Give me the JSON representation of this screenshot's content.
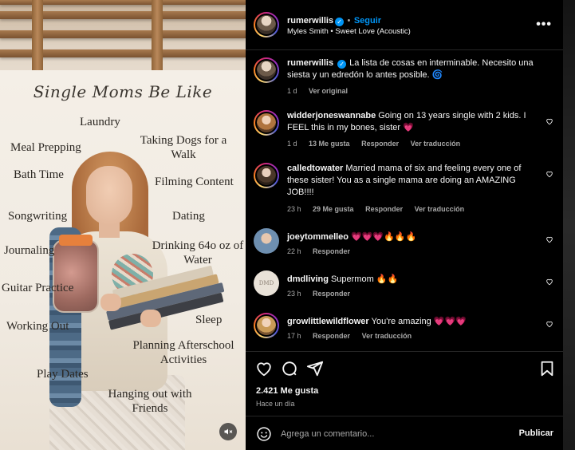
{
  "post": {
    "username": "rumerwillis",
    "verified_glyph": "✓",
    "separator": "•",
    "follow_label": "Seguir",
    "audio": "Myles Smith • Sweet Love (Acoustic)",
    "more_label": "•••"
  },
  "media": {
    "poster_title": "Single Moms Be Like",
    "words": [
      "Laundry",
      "Meal Prepping",
      "Taking Dogs for a Walk",
      "Bath Time",
      "Filming Content",
      "Songwriting",
      "Dating",
      "Journaling",
      "Drinking 64o oz of Water",
      "Guitar Practice",
      "Working Out",
      "Sleep",
      "Planning Afterschool Activities",
      "Play Dates",
      "Hanging out with Friends"
    ],
    "mute_icon": "speaker-muted-icon"
  },
  "caption": {
    "username": "rumerwillis",
    "text": "La lista de cosas en interminable. Necesito una siesta y un edredón lo antes posible. 🌀",
    "time": "1 d",
    "see_original": "Ver original"
  },
  "comments": [
    {
      "username": "widderjoneswannabe",
      "text": "Going on 13 years single with 2 kids. I FEEL this in my bones, sister 💗",
      "time": "1 d",
      "likes": "13 Me gusta",
      "reply": "Responder",
      "translate": "Ver traducción"
    },
    {
      "username": "calledtowater",
      "text": "Married mama of six and feeling every one of these sister! You as a single mama are doing an AMAZING JOB!!!!",
      "time": "23 h",
      "likes": "29 Me gusta",
      "reply": "Responder",
      "translate": "Ver traducción"
    },
    {
      "username": "joeytommelleo",
      "text": "💗💗💗🔥🔥🔥",
      "time": "22 h",
      "reply": "Responder"
    },
    {
      "username": "dmdliving",
      "text": "Supermom 🔥🔥",
      "time": "23 h",
      "reply": "Responder",
      "avatar_text": "DMD"
    },
    {
      "username": "growlittlewildflower",
      "text": "You're amazing 💗💗💗",
      "time": "17 h",
      "reply": "Responder",
      "translate": "Ver traducción"
    }
  ],
  "actions": {
    "likes": "2.421 Me gusta",
    "posted": "Hace un día",
    "icons": [
      "heart-icon",
      "comment-icon",
      "share-icon",
      "bookmark-icon"
    ]
  },
  "add_comment": {
    "placeholder": "Agrega un comentario...",
    "publish_label": "Publicar"
  },
  "colors": {
    "accent": "#0095f6",
    "background": "#000000",
    "muted_text": "#a8a8a8",
    "heart": "#ff3040"
  }
}
